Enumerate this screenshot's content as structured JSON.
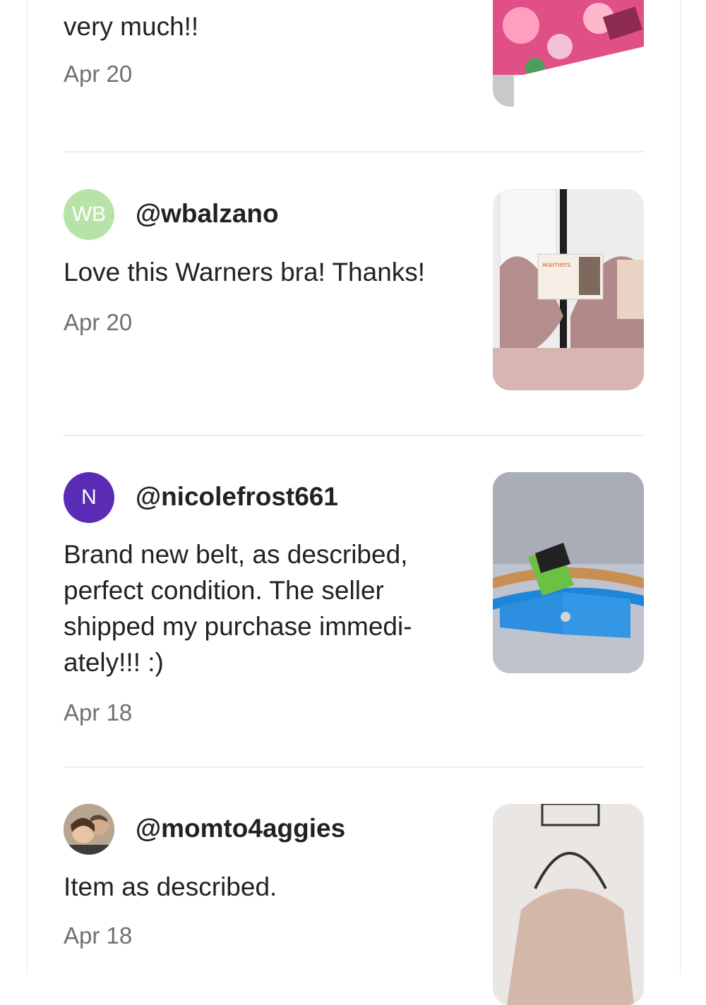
{
  "reviews": [
    {
      "text": "very much!!",
      "date": "Apr 20",
      "image": "floral-bag-photo"
    },
    {
      "avatar_initials": "WB",
      "avatar_color": "#b8e3a8",
      "username": "@wbalzano",
      "text": "Love this Warners bra! Thanks!",
      "date": "Apr 20",
      "image": "bra-photo",
      "image_brand_text": "warners"
    },
    {
      "avatar_initials": "N",
      "avatar_color": "#5a2bb5",
      "username": "@nicolefrost661",
      "text": "Brand new belt, as described, perfect condition. The seller shipped my purchase immedi-ately!!! :)",
      "date": "Apr 18",
      "image": "belt-photo"
    },
    {
      "avatar_initials": "",
      "username": "@momto4aggies",
      "text": "Item as described.",
      "date": "Apr 18",
      "image": "handbag-photo"
    }
  ]
}
